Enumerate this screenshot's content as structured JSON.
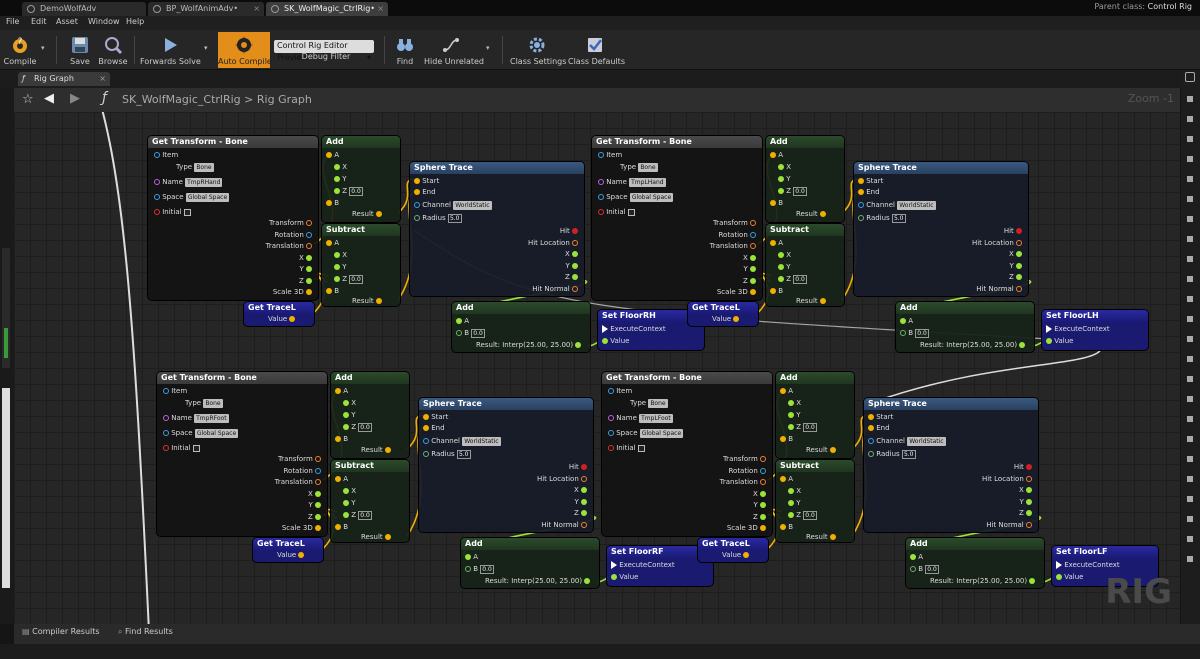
{
  "tabs": [
    {
      "label": "DemoWolfAdv"
    },
    {
      "label": "BP_WolfAnimAdv•"
    },
    {
      "label": "SK_WolfMagic_CtrlRig•"
    }
  ],
  "parent_class": {
    "label": "Parent class:",
    "value": "Control Rig"
  },
  "menu": [
    "File",
    "Edit",
    "Asset",
    "Window",
    "Help"
  ],
  "toolbar": {
    "compile": "Compile",
    "save": "Save",
    "browse": "Browse",
    "forwards_solve": "Forwards Solve",
    "auto_compile": "Auto Compile",
    "debug_combo": "Control Rig Editor Preview",
    "debug_filter": "Debug Filter",
    "find": "Find",
    "hide_unrelated": "Hide Unrelated",
    "class_settings": "Class Settings",
    "class_defaults": "Class Defaults"
  },
  "graph_tab": "Rig Graph",
  "breadcrumb": {
    "asset": "SK_WolfMagic_CtrlRig",
    "sep": ">",
    "graph": "Rig Graph"
  },
  "zoom": "Zoom -1",
  "watermark": "RIG",
  "bottom_tabs": [
    "Compiler Results",
    "Find Results"
  ],
  "labels": {
    "get_transform": "Get Transform - Bone",
    "item": "Item",
    "type": "Type",
    "type_val": "Bone",
    "name": "Name",
    "space": "Space",
    "space_val": "Global Space",
    "initial": "Initial",
    "transform": "Transform",
    "rotation": "Rotation",
    "translation": "Translation",
    "x": "X",
    "y": "Y",
    "z": "Z",
    "scale3d": "Scale 3D",
    "add": "Add",
    "subtract": "Subtract",
    "a": "A",
    "b": "B",
    "result": "Result",
    "zero": "0.0",
    "sphere_trace": "Sphere Trace",
    "start": "Start",
    "end": "End",
    "channel": "Channel",
    "channel_val": "WorldStatic",
    "radius": "Radius",
    "radius_val": "5.0",
    "hit": "Hit",
    "hit_location": "Hit Location",
    "hit_normal": "Hit Normal",
    "get_tracel": "Get TraceL",
    "value": "Value",
    "execute_context": "ExecuteContext",
    "interp_result": "Result:",
    "interp_val": "Interp(25.00, 25.00)"
  },
  "groups": [
    {
      "bone": "TmpRHand",
      "setter": "Set FloorRH"
    },
    {
      "bone": "TmpLHand",
      "setter": "Set FloorLH"
    },
    {
      "bone": "TmpRFoot",
      "setter": "Set FloorRF"
    },
    {
      "bone": "TmpLFoot",
      "setter": "Set FloorLF"
    }
  ],
  "colors": {
    "accent": "#e38d1a",
    "exec_node": "#1a1a78",
    "vector_pin": "#f0b000",
    "float_pin": "#9ae33a"
  }
}
